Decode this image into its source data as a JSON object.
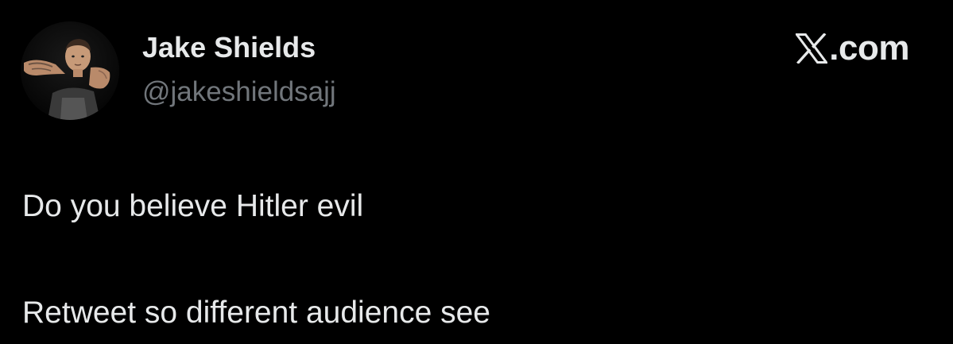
{
  "author": {
    "display_name": "Jake Shields",
    "handle": "@jakeshieldsajj",
    "avatar_icon": "profile-photo"
  },
  "brand": {
    "icon": "x-logo-icon",
    "text": ".com"
  },
  "post": {
    "lines": [
      "Do you believe Hitler evil",
      "Retweet so different audience see"
    ]
  },
  "colors": {
    "background": "#000000",
    "primary_text": "#e7e9ea",
    "secondary_text": "#71767b"
  }
}
